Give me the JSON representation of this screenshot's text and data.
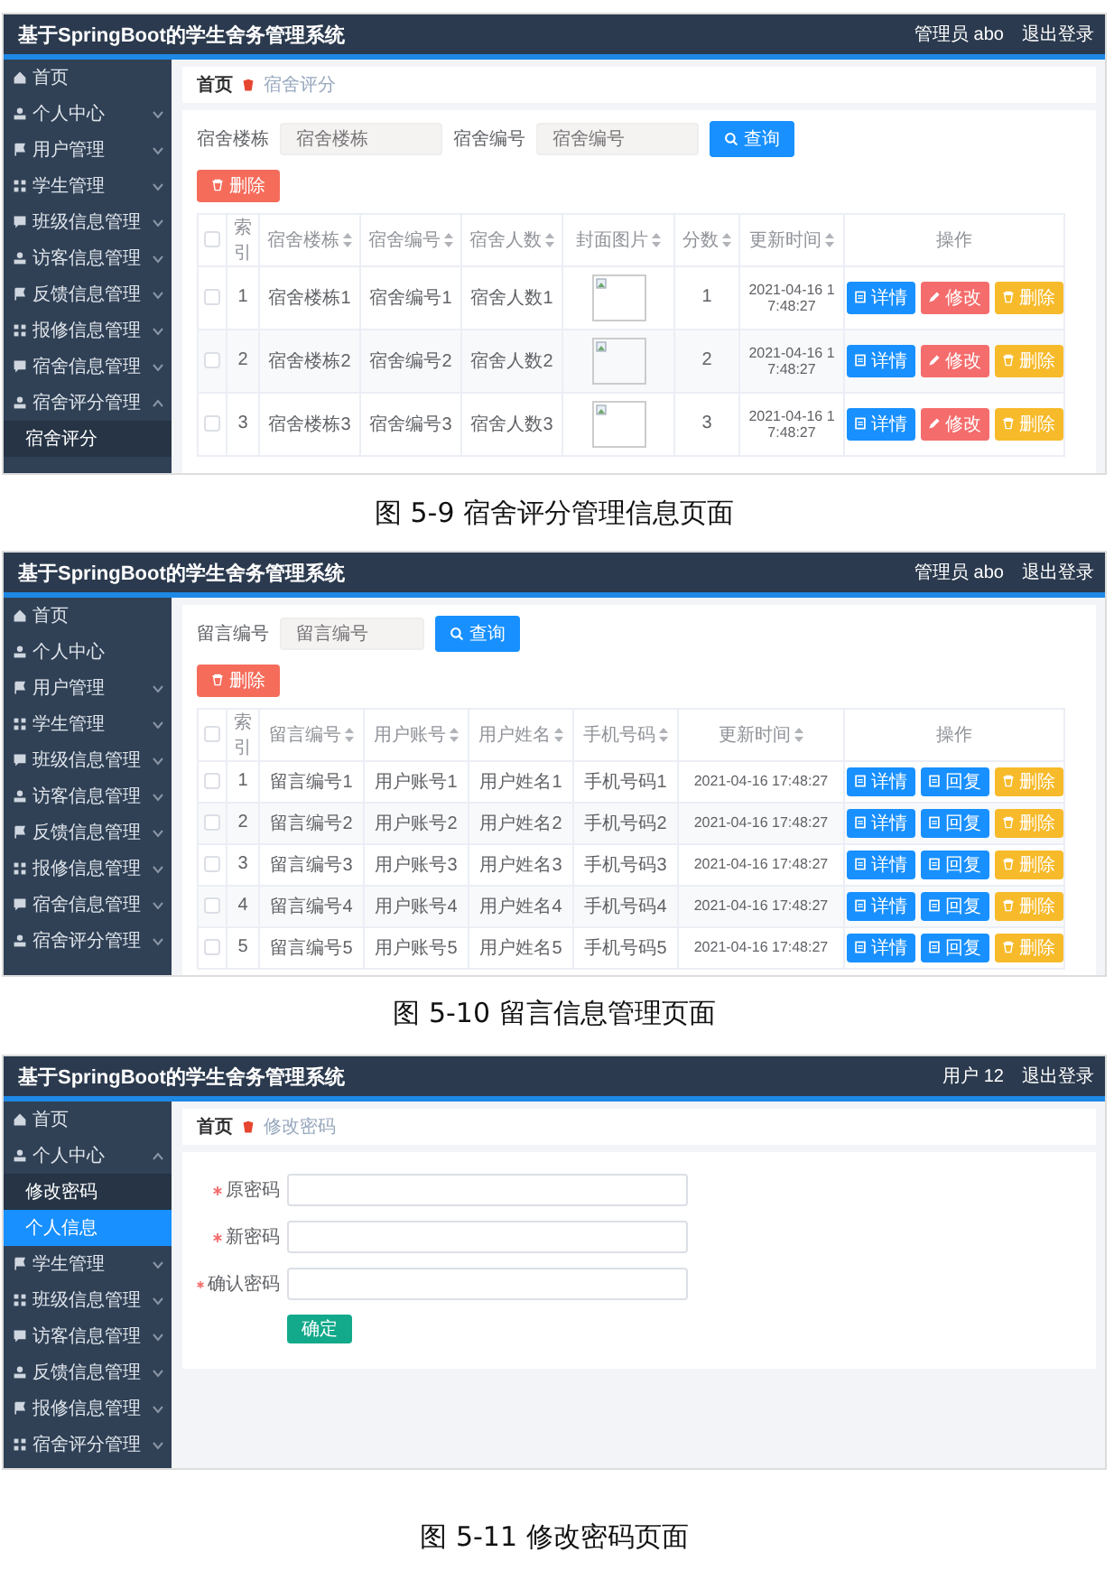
{
  "figures": [
    {
      "kind": "table_page",
      "header": {
        "title": "基于SpringBoot的学生舍务管理系统",
        "user": "管理员 abo",
        "logout": "退出登录"
      },
      "sidebar": [
        {
          "label": "首页"
        },
        {
          "label": "个人中心",
          "expanded": false
        },
        {
          "label": "用户管理",
          "expanded": false
        },
        {
          "label": "学生管理",
          "expanded": false
        },
        {
          "label": "班级信息管理",
          "expanded": false
        },
        {
          "label": "访客信息管理",
          "expanded": false
        },
        {
          "label": "反馈信息管理",
          "expanded": false
        },
        {
          "label": "报修信息管理",
          "expanded": false
        },
        {
          "label": "宿舍信息管理",
          "expanded": false
        },
        {
          "label": "宿舍评分管理",
          "expanded": true,
          "children": [
            {
              "label": "宿舍评分",
              "selected": false
            }
          ]
        }
      ],
      "breadcrumb": [
        "首页",
        "宿舍评分"
      ],
      "filters": [
        {
          "label": "宿舍楼栋",
          "placeholder": "宿舍楼栋"
        },
        {
          "label": "宿舍编号",
          "placeholder": "宿舍编号"
        }
      ],
      "search_button": "查询",
      "delete_button": "删除",
      "table": {
        "select_all": false,
        "columns": [
          {
            "label": "索引",
            "kind": "text",
            "sortable": false
          },
          {
            "label": "宿舍楼栋",
            "kind": "text",
            "sortable": true
          },
          {
            "label": "宿舍编号",
            "kind": "text",
            "sortable": true
          },
          {
            "label": "宿舍人数",
            "kind": "text",
            "sortable": true
          },
          {
            "label": "封面图片",
            "kind": "image",
            "sortable": true
          },
          {
            "label": "分数",
            "kind": "text",
            "sortable": true
          },
          {
            "label": "更新时间",
            "kind": "text",
            "sortable": true
          },
          {
            "label": "操作",
            "kind": "actions",
            "sortable": false
          }
        ],
        "rows": [
          {
            "checked": false,
            "cells": [
              "1",
              "宿舍楼栋1",
              "宿舍编号1",
              "宿舍人数1",
              "",
              "1",
              "2021-04-16 17:48:27"
            ],
            "actions": [
              {
                "label": "详情",
                "kind": "view"
              },
              {
                "label": "修改",
                "kind": "edit"
              },
              {
                "label": "删除",
                "kind": "delete"
              }
            ]
          },
          {
            "checked": false,
            "cells": [
              "2",
              "宿舍楼栋2",
              "宿舍编号2",
              "宿舍人数2",
              "",
              "2",
              "2021-04-16 17:48:27"
            ],
            "actions": [
              {
                "label": "详情",
                "kind": "view"
              },
              {
                "label": "修改",
                "kind": "edit"
              },
              {
                "label": "删除",
                "kind": "delete"
              }
            ]
          },
          {
            "checked": false,
            "cells": [
              "3",
              "宿舍楼栋3",
              "宿舍编号3",
              "宿舍人数3",
              "",
              "3",
              "2021-04-16 17:48:27"
            ],
            "actions": [
              {
                "label": "详情",
                "kind": "view"
              },
              {
                "label": "修改",
                "kind": "edit"
              },
              {
                "label": "删除",
                "kind": "delete"
              }
            ]
          }
        ]
      },
      "caption": "图 5-9 宿舍评分管理信息页面"
    },
    {
      "kind": "table_page",
      "header": {
        "title": "基于SpringBoot的学生舍务管理系统",
        "user": "管理员 abo",
        "logout": "退出登录"
      },
      "sidebar": [
        {
          "label": "首页"
        },
        {
          "label": "个人中心"
        },
        {
          "label": "用户管理",
          "expanded": false
        },
        {
          "label": "学生管理",
          "expanded": false
        },
        {
          "label": "班级信息管理",
          "expanded": false
        },
        {
          "label": "访客信息管理",
          "expanded": false
        },
        {
          "label": "反馈信息管理",
          "expanded": false
        },
        {
          "label": "报修信息管理",
          "expanded": false
        },
        {
          "label": "宿舍信息管理",
          "expanded": false
        },
        {
          "label": "宿舍评分管理",
          "expanded": false
        }
      ],
      "filters": [
        {
          "label": "留言编号",
          "placeholder": "留言编号"
        }
      ],
      "search_button": "查询",
      "delete_button": "删除",
      "table": {
        "select_all": false,
        "columns": [
          {
            "label": "索引",
            "kind": "text",
            "sortable": false
          },
          {
            "label": "留言编号",
            "kind": "text",
            "sortable": true
          },
          {
            "label": "用户账号",
            "kind": "text",
            "sortable": true
          },
          {
            "label": "用户姓名",
            "kind": "text",
            "sortable": true
          },
          {
            "label": "手机号码",
            "kind": "text",
            "sortable": true
          },
          {
            "label": "更新时间",
            "kind": "text",
            "sortable": true
          },
          {
            "label": "操作",
            "kind": "actions",
            "sortable": false
          }
        ],
        "rows": [
          {
            "checked": false,
            "cells": [
              "1",
              "留言编号1",
              "用户账号1",
              "用户姓名1",
              "手机号码1",
              "2021-04-16 17:48:27"
            ],
            "actions": [
              {
                "label": "详情",
                "kind": "view"
              },
              {
                "label": "回复",
                "kind": "reply"
              },
              {
                "label": "删除",
                "kind": "delete"
              }
            ]
          },
          {
            "checked": false,
            "cells": [
              "2",
              "留言编号2",
              "用户账号2",
              "用户姓名2",
              "手机号码2",
              "2021-04-16 17:48:27"
            ],
            "actions": [
              {
                "label": "详情",
                "kind": "view"
              },
              {
                "label": "回复",
                "kind": "reply"
              },
              {
                "label": "删除",
                "kind": "delete"
              }
            ]
          },
          {
            "checked": false,
            "cells": [
              "3",
              "留言编号3",
              "用户账号3",
              "用户姓名3",
              "手机号码3",
              "2021-04-16 17:48:27"
            ],
            "actions": [
              {
                "label": "详情",
                "kind": "view"
              },
              {
                "label": "回复",
                "kind": "reply"
              },
              {
                "label": "删除",
                "kind": "delete"
              }
            ]
          },
          {
            "checked": false,
            "cells": [
              "4",
              "留言编号4",
              "用户账号4",
              "用户姓名4",
              "手机号码4",
              "2021-04-16 17:48:27"
            ],
            "actions": [
              {
                "label": "详情",
                "kind": "view"
              },
              {
                "label": "回复",
                "kind": "reply"
              },
              {
                "label": "删除",
                "kind": "delete"
              }
            ]
          },
          {
            "checked": false,
            "cells": [
              "5",
              "留言编号5",
              "用户账号5",
              "用户姓名5",
              "手机号码5",
              "2021-04-16 17:48:27"
            ],
            "actions": [
              {
                "label": "详情",
                "kind": "view"
              },
              {
                "label": "回复",
                "kind": "reply"
              },
              {
                "label": "删除",
                "kind": "delete"
              }
            ]
          }
        ]
      },
      "caption": "图 5-10 留言信息管理页面"
    },
    {
      "kind": "form_page",
      "header": {
        "title": "基于SpringBoot的学生舍务管理系统",
        "user": "用户 12",
        "logout": "退出登录"
      },
      "sidebar": [
        {
          "label": "首页"
        },
        {
          "label": "个人中心",
          "expanded": true,
          "children": [
            {
              "label": "修改密码",
              "selected": false
            },
            {
              "label": "个人信息",
              "selected": true
            }
          ]
        },
        {
          "label": "学生管理",
          "expanded": false
        },
        {
          "label": "班级信息管理",
          "expanded": false
        },
        {
          "label": "访客信息管理",
          "expanded": false
        },
        {
          "label": "反馈信息管理",
          "expanded": false
        },
        {
          "label": "报修信息管理",
          "expanded": false
        },
        {
          "label": "宿舍评分管理",
          "expanded": false
        }
      ],
      "breadcrumb": [
        "首页",
        "修改密码"
      ],
      "form": {
        "fields": [
          {
            "label": "原密码",
            "required": true
          },
          {
            "label": "新密码",
            "required": true
          },
          {
            "label": "确认密码",
            "required": true
          }
        ],
        "submit": "确定"
      },
      "caption": "图 5-11 修改密码页面"
    }
  ]
}
